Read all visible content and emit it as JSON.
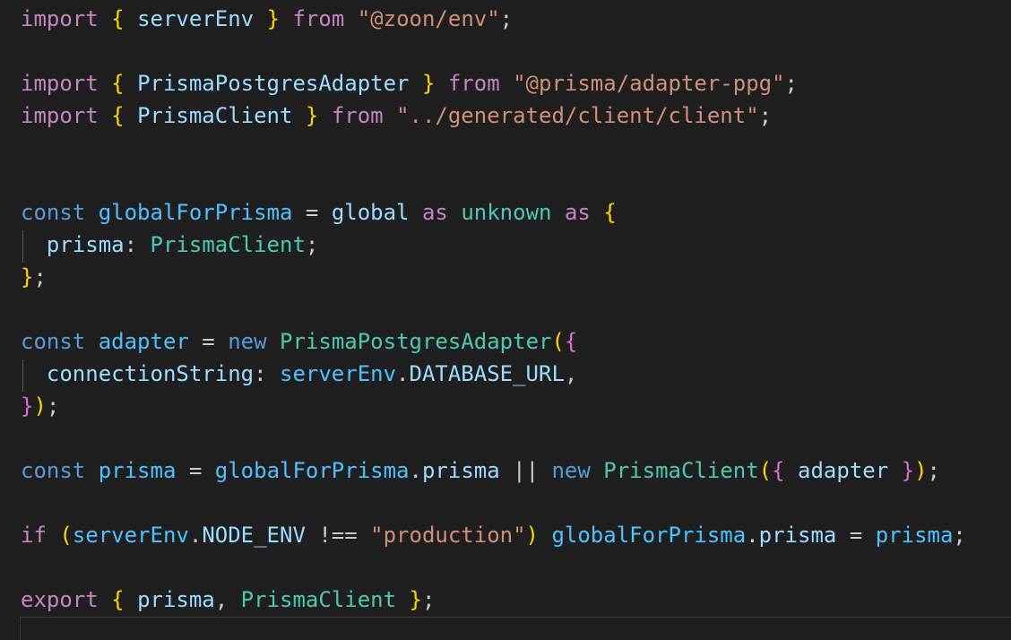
{
  "editor": {
    "theme_colors": {
      "background": "#1f1f1f",
      "keyword_control": "#c586c0",
      "keyword_storage": "#569cd6",
      "variable": "#9cdcfe",
      "constant": "#4fc1ff",
      "type": "#4ec9b0",
      "string": "#ce9178",
      "punctuation": "#cccccc",
      "bracket_level_1": "#ffd700",
      "bracket_level_2": "#da70d6",
      "bracket_level_3": "#179fff"
    },
    "lines": [
      {
        "tokens": [
          {
            "t": "import",
            "c": "kw-ctrl"
          },
          {
            "t": " ",
            "c": "punc"
          },
          {
            "t": "{",
            "c": "b1"
          },
          {
            "t": " ",
            "c": "punc"
          },
          {
            "t": "serverEnv",
            "c": "var"
          },
          {
            "t": " ",
            "c": "punc"
          },
          {
            "t": "}",
            "c": "b1"
          },
          {
            "t": " ",
            "c": "punc"
          },
          {
            "t": "from",
            "c": "kw-ctrl"
          },
          {
            "t": " ",
            "c": "punc"
          },
          {
            "t": "\"@zoon/env\"",
            "c": "str"
          },
          {
            "t": ";",
            "c": "punc"
          }
        ]
      },
      {
        "tokens": []
      },
      {
        "tokens": [
          {
            "t": "import",
            "c": "kw-ctrl"
          },
          {
            "t": " ",
            "c": "punc"
          },
          {
            "t": "{",
            "c": "b1"
          },
          {
            "t": " ",
            "c": "punc"
          },
          {
            "t": "PrismaPostgresAdapter",
            "c": "var"
          },
          {
            "t": " ",
            "c": "punc"
          },
          {
            "t": "}",
            "c": "b1"
          },
          {
            "t": " ",
            "c": "punc"
          },
          {
            "t": "from",
            "c": "kw-ctrl"
          },
          {
            "t": " ",
            "c": "punc"
          },
          {
            "t": "\"@prisma/adapter-ppg\"",
            "c": "str"
          },
          {
            "t": ";",
            "c": "punc"
          }
        ]
      },
      {
        "tokens": [
          {
            "t": "import",
            "c": "kw-ctrl"
          },
          {
            "t": " ",
            "c": "punc"
          },
          {
            "t": "{",
            "c": "b1"
          },
          {
            "t": " ",
            "c": "punc"
          },
          {
            "t": "PrismaClient",
            "c": "var"
          },
          {
            "t": " ",
            "c": "punc"
          },
          {
            "t": "}",
            "c": "b1"
          },
          {
            "t": " ",
            "c": "punc"
          },
          {
            "t": "from",
            "c": "kw-ctrl"
          },
          {
            "t": " ",
            "c": "punc"
          },
          {
            "t": "\"../generated/client/client\"",
            "c": "str"
          },
          {
            "t": ";",
            "c": "punc"
          }
        ]
      },
      {
        "tokens": []
      },
      {
        "tokens": []
      },
      {
        "tokens": [
          {
            "t": "const",
            "c": "kw"
          },
          {
            "t": " ",
            "c": "punc"
          },
          {
            "t": "globalForPrisma",
            "c": "const"
          },
          {
            "t": " = ",
            "c": "punc"
          },
          {
            "t": "global",
            "c": "var"
          },
          {
            "t": " ",
            "c": "punc"
          },
          {
            "t": "as",
            "c": "kw-ctrl"
          },
          {
            "t": " ",
            "c": "punc"
          },
          {
            "t": "unknown",
            "c": "type"
          },
          {
            "t": " ",
            "c": "punc"
          },
          {
            "t": "as",
            "c": "kw-ctrl"
          },
          {
            "t": " ",
            "c": "punc"
          },
          {
            "t": "{",
            "c": "b1"
          }
        ]
      },
      {
        "tokens": [
          {
            "t": "  ",
            "c": "punc"
          },
          {
            "t": "prisma",
            "c": "var"
          },
          {
            "t": ": ",
            "c": "punc"
          },
          {
            "t": "PrismaClient",
            "c": "type"
          },
          {
            "t": ";",
            "c": "punc"
          }
        ]
      },
      {
        "tokens": [
          {
            "t": "}",
            "c": "b1"
          },
          {
            "t": ";",
            "c": "punc"
          }
        ]
      },
      {
        "tokens": []
      },
      {
        "tokens": [
          {
            "t": "const",
            "c": "kw"
          },
          {
            "t": " ",
            "c": "punc"
          },
          {
            "t": "adapter",
            "c": "const"
          },
          {
            "t": " = ",
            "c": "punc"
          },
          {
            "t": "new",
            "c": "kw"
          },
          {
            "t": " ",
            "c": "punc"
          },
          {
            "t": "PrismaPostgresAdapter",
            "c": "type"
          },
          {
            "t": "(",
            "c": "b1"
          },
          {
            "t": "{",
            "c": "b2"
          }
        ]
      },
      {
        "tokens": [
          {
            "t": "  ",
            "c": "punc"
          },
          {
            "t": "connectionString",
            "c": "var"
          },
          {
            "t": ": ",
            "c": "punc"
          },
          {
            "t": "serverEnv",
            "c": "const"
          },
          {
            "t": ".",
            "c": "punc"
          },
          {
            "t": "DATABASE_URL",
            "c": "var"
          },
          {
            "t": ",",
            "c": "punc"
          }
        ]
      },
      {
        "tokens": [
          {
            "t": "}",
            "c": "b2"
          },
          {
            "t": ")",
            "c": "b1"
          },
          {
            "t": ";",
            "c": "punc"
          }
        ]
      },
      {
        "tokens": []
      },
      {
        "tokens": [
          {
            "t": "const",
            "c": "kw"
          },
          {
            "t": " ",
            "c": "punc"
          },
          {
            "t": "prisma",
            "c": "const"
          },
          {
            "t": " = ",
            "c": "punc"
          },
          {
            "t": "globalForPrisma",
            "c": "const"
          },
          {
            "t": ".",
            "c": "punc"
          },
          {
            "t": "prisma",
            "c": "var"
          },
          {
            "t": " || ",
            "c": "punc"
          },
          {
            "t": "new",
            "c": "kw"
          },
          {
            "t": " ",
            "c": "punc"
          },
          {
            "t": "PrismaClient",
            "c": "type"
          },
          {
            "t": "(",
            "c": "b1"
          },
          {
            "t": "{",
            "c": "b2"
          },
          {
            "t": " ",
            "c": "punc"
          },
          {
            "t": "adapter",
            "c": "var"
          },
          {
            "t": " ",
            "c": "punc"
          },
          {
            "t": "}",
            "c": "b2"
          },
          {
            "t": ")",
            "c": "b1"
          },
          {
            "t": ";",
            "c": "punc"
          }
        ]
      },
      {
        "tokens": []
      },
      {
        "tokens": [
          {
            "t": "if",
            "c": "kw-ctrl"
          },
          {
            "t": " ",
            "c": "punc"
          },
          {
            "t": "(",
            "c": "b1"
          },
          {
            "t": "serverEnv",
            "c": "const"
          },
          {
            "t": ".",
            "c": "punc"
          },
          {
            "t": "NODE_ENV",
            "c": "var"
          },
          {
            "t": " !== ",
            "c": "punc"
          },
          {
            "t": "\"production\"",
            "c": "str"
          },
          {
            "t": ")",
            "c": "b1"
          },
          {
            "t": " ",
            "c": "punc"
          },
          {
            "t": "globalForPrisma",
            "c": "const"
          },
          {
            "t": ".",
            "c": "punc"
          },
          {
            "t": "prisma",
            "c": "var"
          },
          {
            "t": " = ",
            "c": "punc"
          },
          {
            "t": "prisma",
            "c": "const"
          },
          {
            "t": ";",
            "c": "punc"
          }
        ]
      },
      {
        "tokens": []
      },
      {
        "tokens": [
          {
            "t": "export",
            "c": "kw-ctrl"
          },
          {
            "t": " ",
            "c": "punc"
          },
          {
            "t": "{",
            "c": "b1"
          },
          {
            "t": " ",
            "c": "punc"
          },
          {
            "t": "prisma",
            "c": "var"
          },
          {
            "t": ", ",
            "c": "punc"
          },
          {
            "t": "PrismaClient",
            "c": "type"
          },
          {
            "t": " ",
            "c": "punc"
          },
          {
            "t": "}",
            "c": "b1"
          },
          {
            "t": ";",
            "c": "punc"
          }
        ]
      },
      {
        "tokens": []
      }
    ]
  }
}
